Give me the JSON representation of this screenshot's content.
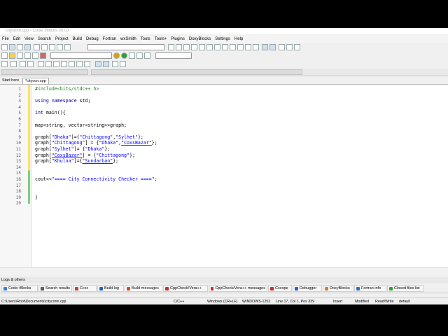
{
  "window": {
    "title": "cityconn.cpp - Code::Blocks 20.03"
  },
  "menu": [
    "File",
    "Edit",
    "View",
    "Search",
    "Project",
    "Build",
    "Debug",
    "Fortran",
    "wxSmith",
    "Tools",
    "Tools+",
    "Plugins",
    "DoxyBlocks",
    "Settings",
    "Help"
  ],
  "tabs": [
    {
      "label": "Start here",
      "active": false
    },
    {
      "label": "*citycon.cpp",
      "active": true
    }
  ],
  "editor": {
    "line_numbers": [
      "1",
      "2",
      "3",
      "4",
      "5",
      "6",
      "7",
      "8",
      "9",
      "10",
      "11",
      "12",
      "13",
      "14",
      "15",
      "16",
      "17",
      "18",
      "19",
      "20"
    ],
    "lines": [
      [
        {
          "t": "#include<bits/stdc++.h>",
          "c": "pp"
        }
      ],
      [],
      [
        {
          "t": "using namespace ",
          "c": "kw"
        },
        {
          "t": "std;",
          "c": ""
        }
      ],
      [],
      [
        {
          "t": "int ",
          "c": "kw"
        },
        {
          "t": "main(){",
          "c": ""
        }
      ],
      [],
      [
        {
          "t": "map<string, vector<string>>graph;",
          "c": ""
        }
      ],
      [],
      [
        {
          "t": "graph[",
          "c": ""
        },
        {
          "t": "\"Dhaka\"",
          "c": "str"
        },
        {
          "t": "]={",
          "c": ""
        },
        {
          "t": "\"Chittagong\"",
          "c": "str"
        },
        {
          "t": ",",
          "c": ""
        },
        {
          "t": "\"Sylhet\"",
          "c": "str"
        },
        {
          "t": "};",
          "c": ""
        }
      ],
      [
        {
          "t": "graph[",
          "c": ""
        },
        {
          "t": "\"Chittagong\"",
          "c": "str"
        },
        {
          "t": "] = {",
          "c": ""
        },
        {
          "t": "\"Dhaka\"",
          "c": "str"
        },
        {
          "t": ",",
          "c": ""
        },
        {
          "t": "\"CoxsBazar\"",
          "c": "str ul"
        },
        {
          "t": "};",
          "c": ""
        }
      ],
      [
        {
          "t": "graph[",
          "c": ""
        },
        {
          "t": "\"Sylhet\"",
          "c": "str"
        },
        {
          "t": "]= {",
          "c": ""
        },
        {
          "t": "\"Dhaka\"",
          "c": "str"
        },
        {
          "t": "};",
          "c": ""
        }
      ],
      [
        {
          "t": "graph[",
          "c": ""
        },
        {
          "t": "\"CoxsBazar\"",
          "c": "str ul"
        },
        {
          "t": "] = {",
          "c": ""
        },
        {
          "t": "\"Chittagong\"",
          "c": "str"
        },
        {
          "t": "};",
          "c": ""
        }
      ],
      [
        {
          "t": "graph[",
          "c": ""
        },
        {
          "t": "\"Khulna\"",
          "c": "str"
        },
        {
          "t": "]={",
          "c": ""
        },
        {
          "t": "\"Sundarban\"",
          "c": "str ul"
        },
        {
          "t": "};",
          "c": ""
        }
      ],
      [],
      [],
      [
        {
          "t": "cout<<",
          "c": ""
        },
        {
          "t": "\"==== City Connectivity Checker ====\"",
          "c": "str"
        },
        {
          "t": ";",
          "c": ""
        }
      ],
      [],
      [],
      [
        {
          "t": "}",
          "c": ""
        }
      ],
      []
    ]
  },
  "logs": {
    "title": "Logs & others",
    "tabs": [
      {
        "label": "Code::Blocks",
        "color": "#3a7bd5"
      },
      {
        "label": "Search results",
        "color": "#5a5a5a"
      },
      {
        "label": "Cccc",
        "color": "#c04040"
      },
      {
        "label": "Build log",
        "color": "#2060c0"
      },
      {
        "label": "Build messages",
        "color": "#d05020",
        "active": true
      },
      {
        "label": "CppCheck/Vera++",
        "color": "#c03030"
      },
      {
        "label": "CppCheck/Vera++ messages",
        "color": "#c03030"
      },
      {
        "label": "Cscope",
        "color": "#c03030"
      },
      {
        "label": "Debugger",
        "color": "#3060c0"
      },
      {
        "label": "DoxyBlocks",
        "color": "#d08030"
      },
      {
        "label": "Fortran info",
        "color": "#3070b0"
      },
      {
        "label": "Closed files list",
        "color": "#30a030"
      }
    ]
  },
  "status": {
    "path": "C:\\Users\\Root\\Documents\\cityconn.cpp",
    "lang": "C/C++",
    "eol": "Windows (CR+LF)",
    "encoding": "WINDOWS-1252",
    "position": "Line 17, Col 1, Pos 339",
    "mode": "Insert",
    "modified": "Modified",
    "rw": "Read/Write",
    "profile": "default"
  }
}
